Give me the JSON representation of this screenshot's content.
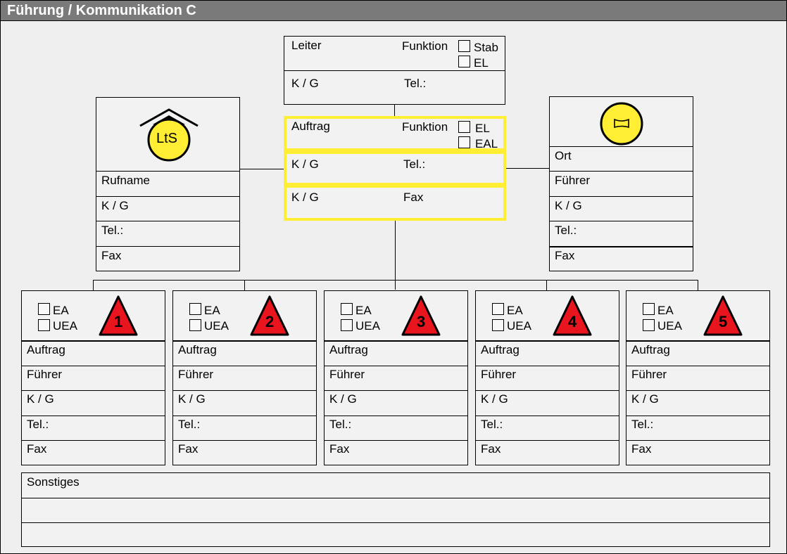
{
  "title": "Führung / Kommunikation C",
  "leader": {
    "leiter": "Leiter",
    "funktion": "Funktion",
    "opt1": "Stab",
    "opt2": "EL",
    "kg": "K / G",
    "tel": "Tel.:"
  },
  "auftrag_box": {
    "auftrag": "Auftrag",
    "funktion": "Funktion",
    "opt1": "EL",
    "opt2": "EAL",
    "kg": "K / G",
    "tel": "Tel.:",
    "kg2": "K / G",
    "fax": "Fax"
  },
  "lts_box": {
    "logo_text": "LtS",
    "rows": [
      "Rufname",
      "K / G",
      "Tel.:",
      "Fax"
    ]
  },
  "ort_box": {
    "rows": [
      "Ort",
      "Führer",
      "K / G",
      "Tel.:",
      "Fax"
    ]
  },
  "units": [
    {
      "num": "1",
      "ea": "EA",
      "uea": "UEA",
      "rows": [
        "Auftrag",
        "Führer",
        "K / G",
        "Tel.:",
        "Fax"
      ]
    },
    {
      "num": "2",
      "ea": "EA",
      "uea": "UEA",
      "rows": [
        "Auftrag",
        "Führer",
        "K / G",
        "Tel.:",
        "Fax"
      ]
    },
    {
      "num": "3",
      "ea": "EA",
      "uea": "UEA",
      "rows": [
        "Auftrag",
        "Führer",
        "K / G",
        "Tel.:",
        "Fax"
      ]
    },
    {
      "num": "4",
      "ea": "EA",
      "uea": "UEA",
      "rows": [
        "Auftrag",
        "Führer",
        "K / G",
        "Tel.:",
        "Fax"
      ]
    },
    {
      "num": "5",
      "ea": "EA",
      "uea": "UEA",
      "rows": [
        "Auftrag",
        "Führer",
        "K / G",
        "Tel.:",
        "Fax"
      ]
    }
  ],
  "sonstiges": "Sonstiges",
  "colors": {
    "yellow": "#ffee33",
    "red": "#e8141e",
    "titlebar": "#7a7a7a"
  }
}
